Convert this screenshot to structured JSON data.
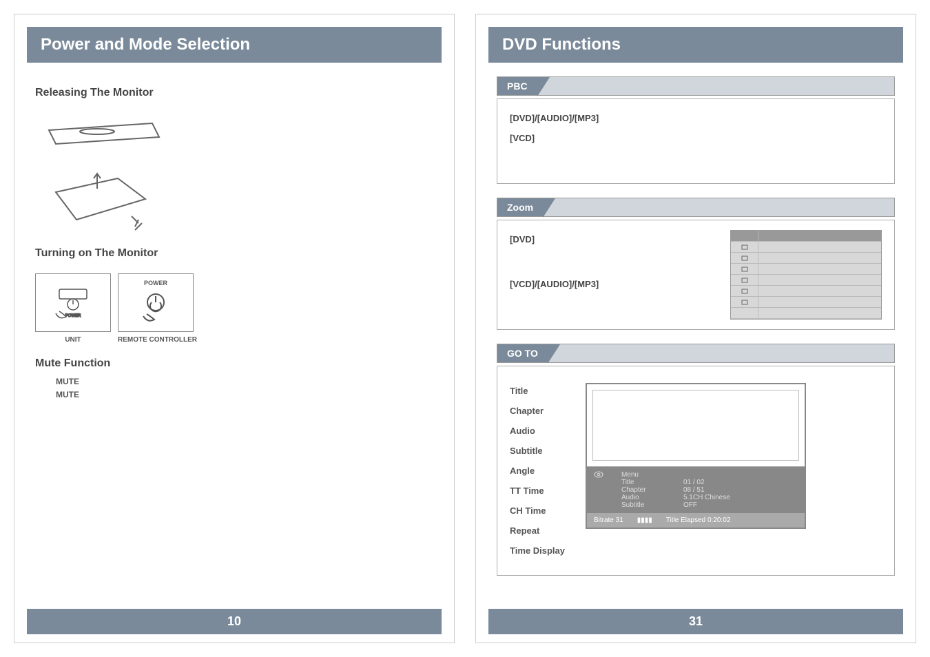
{
  "left_page": {
    "title": "Power and Mode Selection",
    "section1": "Releasing The Monitor",
    "section2": "Turning on The Monitor",
    "power_label": "POWER",
    "unit_label": "UNIT",
    "remote_label": "REMOTE CONTROLLER",
    "section3": "Mute Function",
    "mute1": "MUTE",
    "mute2": "MUTE",
    "page_number": "10"
  },
  "right_page": {
    "title": "DVD Functions",
    "pbc": {
      "tag": "PBC",
      "line1": "[DVD]/[AUDIO]/[MP3]",
      "line2": "[VCD]"
    },
    "zoom": {
      "tag": "Zoom",
      "line1": "[DVD]",
      "line2": "[VCD]/[AUDIO]/[MP3]"
    },
    "goto": {
      "tag": "GO TO",
      "labels": [
        "Title",
        "Chapter",
        "Audio",
        "Subtitle",
        "Angle",
        "TT Time",
        "CH Time",
        "Repeat",
        "Time Display"
      ],
      "osd": {
        "menu": "Menu",
        "rows": [
          {
            "k": "Title",
            "v": "01 / 02"
          },
          {
            "k": "Chapter",
            "v": "08 / 51"
          },
          {
            "k": "Audio",
            "v": "5.1CH Chinese"
          },
          {
            "k": "Subtitle",
            "v": "OFF"
          }
        ],
        "bitrate_label": "Bitrate 31",
        "elapsed": "Title Elapsed 0:20:02"
      }
    },
    "page_number": "31"
  }
}
